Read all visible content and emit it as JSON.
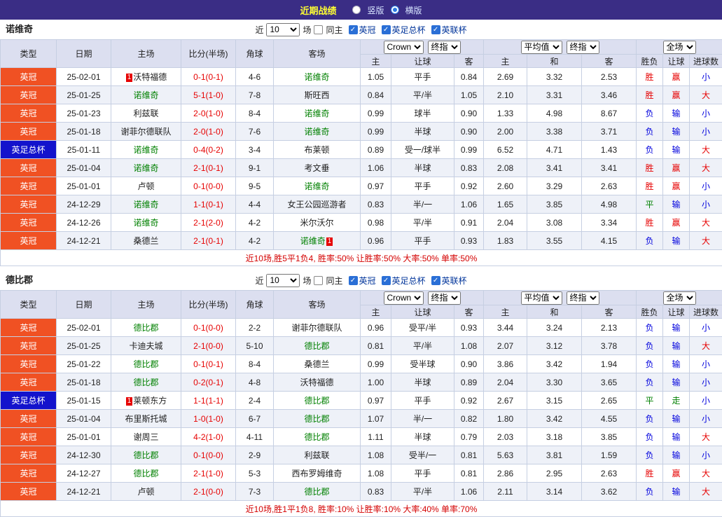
{
  "topbar": {
    "title": "近期战绩",
    "options": [
      {
        "label": "竖版",
        "selected": false
      },
      {
        "label": "横版",
        "selected": true
      }
    ]
  },
  "colors": {
    "topbar_bg": "#3a2d85",
    "league_championship_bg": "#f05123",
    "league_facup_bg": "#1313cc",
    "focus_team": "#008000",
    "win": "#e60000",
    "draw": "#008000",
    "loss": "#0000dd",
    "score": "#e60000",
    "summary": "#d40000"
  },
  "filter": {
    "near_label": "近",
    "count": "10",
    "matches_label": "场",
    "same_home": {
      "label": "同主",
      "checked": false
    },
    "leagues": [
      {
        "label": "英冠",
        "checked": true
      },
      {
        "label": "英足总杯",
        "checked": true
      },
      {
        "label": "英联杯",
        "checked": true
      }
    ]
  },
  "table_header": {
    "left_cols": [
      "类型",
      "日期",
      "主场",
      "比分(半场)",
      "角球",
      "客场"
    ],
    "groups": [
      {
        "selects": [
          "Crown",
          "终指"
        ],
        "cols": [
          "主",
          "让球",
          "客"
        ]
      },
      {
        "selects": [
          "平均值",
          "终指"
        ],
        "cols": [
          "主",
          "和",
          "客"
        ]
      },
      {
        "selects": [
          "全场"
        ],
        "cols": [
          "胜负",
          "让球",
          "进球数"
        ]
      }
    ]
  },
  "sections": [
    {
      "team": "诺维奇",
      "rows": [
        {
          "type": "英冠",
          "type_color": "orange",
          "date": "25-02-01",
          "home": "沃特福德",
          "home_badge": {
            "text": "1",
            "pos": "before"
          },
          "score": "0-1(0-1)",
          "corners": "4-6",
          "away": "诺维奇",
          "odds_asia": [
            "1.05",
            "平手",
            "0.84"
          ],
          "odds_europe": [
            "2.69",
            "3.32",
            "2.53"
          ],
          "results": [
            "胜",
            "赢",
            "小"
          ]
        },
        {
          "type": "英冠",
          "type_color": "orange",
          "date": "25-01-25",
          "home": "诺维奇",
          "score": "5-1(1-0)",
          "corners": "7-8",
          "away": "斯旺西",
          "odds_asia": [
            "0.84",
            "平/半",
            "1.05"
          ],
          "odds_europe": [
            "2.10",
            "3.31",
            "3.46"
          ],
          "results": [
            "胜",
            "赢",
            "大"
          ]
        },
        {
          "type": "英冠",
          "type_color": "orange",
          "date": "25-01-23",
          "home": "利兹联",
          "score": "2-0(1-0)",
          "corners": "8-4",
          "away": "诺维奇",
          "odds_asia": [
            "0.99",
            "球半",
            "0.90"
          ],
          "odds_europe": [
            "1.33",
            "4.98",
            "8.67"
          ],
          "results": [
            "负",
            "输",
            "小"
          ]
        },
        {
          "type": "英冠",
          "type_color": "orange",
          "date": "25-01-18",
          "home": "谢菲尔德联队",
          "score": "2-0(1-0)",
          "corners": "7-6",
          "away": "诺维奇",
          "odds_asia": [
            "0.99",
            "半球",
            "0.90"
          ],
          "odds_europe": [
            "2.00",
            "3.38",
            "3.71"
          ],
          "results": [
            "负",
            "输",
            "小"
          ]
        },
        {
          "type": "英足总杯",
          "type_color": "blue",
          "date": "25-01-11",
          "home": "诺维奇",
          "score": "0-4(0-2)",
          "corners": "3-4",
          "away": "布莱顿",
          "odds_asia": [
            "0.89",
            "受一/球半",
            "0.99"
          ],
          "odds_europe": [
            "6.52",
            "4.71",
            "1.43"
          ],
          "results": [
            "负",
            "输",
            "大"
          ]
        },
        {
          "type": "英冠",
          "type_color": "orange",
          "date": "25-01-04",
          "home": "诺维奇",
          "score": "2-1(0-1)",
          "corners": "9-1",
          "away": "考文垂",
          "odds_asia": [
            "1.06",
            "半球",
            "0.83"
          ],
          "odds_europe": [
            "2.08",
            "3.41",
            "3.41"
          ],
          "results": [
            "胜",
            "赢",
            "大"
          ]
        },
        {
          "type": "英冠",
          "type_color": "orange",
          "date": "25-01-01",
          "home": "卢顿",
          "score": "0-1(0-0)",
          "corners": "9-5",
          "away": "诺维奇",
          "odds_asia": [
            "0.97",
            "平手",
            "0.92"
          ],
          "odds_europe": [
            "2.60",
            "3.29",
            "2.63"
          ],
          "results": [
            "胜",
            "赢",
            "小"
          ]
        },
        {
          "type": "英冠",
          "type_color": "orange",
          "date": "24-12-29",
          "home": "诺维奇",
          "score": "1-1(0-1)",
          "corners": "4-4",
          "away": "女王公园巡游者",
          "odds_asia": [
            "0.83",
            "半/一",
            "1.06"
          ],
          "odds_europe": [
            "1.65",
            "3.85",
            "4.98"
          ],
          "results": [
            "平",
            "输",
            "小"
          ]
        },
        {
          "type": "英冠",
          "type_color": "orange",
          "date": "24-12-26",
          "home": "诺维奇",
          "score": "2-1(2-0)",
          "corners": "4-2",
          "away": "米尔沃尔",
          "odds_asia": [
            "0.98",
            "平/半",
            "0.91"
          ],
          "odds_europe": [
            "2.04",
            "3.08",
            "3.34"
          ],
          "results": [
            "胜",
            "赢",
            "大"
          ]
        },
        {
          "type": "英冠",
          "type_color": "orange",
          "date": "24-12-21",
          "home": "桑德兰",
          "score": "2-1(0-1)",
          "corners": "4-2",
          "away": "诺维奇",
          "away_badge": {
            "text": "1",
            "pos": "after"
          },
          "odds_asia": [
            "0.96",
            "平手",
            "0.93"
          ],
          "odds_europe": [
            "1.83",
            "3.55",
            "4.15"
          ],
          "results": [
            "负",
            "输",
            "大"
          ]
        }
      ],
      "summary": "近10场,胜5平1负4, 胜率:50% 让胜率:50% 大率:50% 单率:50%"
    },
    {
      "team": "德比郡",
      "rows": [
        {
          "type": "英冠",
          "type_color": "orange",
          "date": "25-02-01",
          "home": "德比郡",
          "score": "0-1(0-0)",
          "corners": "2-2",
          "away": "谢菲尔德联队",
          "odds_asia": [
            "0.96",
            "受平/半",
            "0.93"
          ],
          "odds_europe": [
            "3.44",
            "3.24",
            "2.13"
          ],
          "results": [
            "负",
            "输",
            "小"
          ]
        },
        {
          "type": "英冠",
          "type_color": "orange",
          "date": "25-01-25",
          "home": "卡迪夫城",
          "score": "2-1(0-0)",
          "corners": "5-10",
          "away": "德比郡",
          "odds_asia": [
            "0.81",
            "平/半",
            "1.08"
          ],
          "odds_europe": [
            "2.07",
            "3.12",
            "3.78"
          ],
          "results": [
            "负",
            "输",
            "大"
          ]
        },
        {
          "type": "英冠",
          "type_color": "orange",
          "date": "25-01-22",
          "home": "德比郡",
          "score": "0-1(0-1)",
          "corners": "8-4",
          "away": "桑德兰",
          "odds_asia": [
            "0.99",
            "受半球",
            "0.90"
          ],
          "odds_europe": [
            "3.86",
            "3.42",
            "1.94"
          ],
          "results": [
            "负",
            "输",
            "小"
          ]
        },
        {
          "type": "英冠",
          "type_color": "orange",
          "date": "25-01-18",
          "home": "德比郡",
          "score": "0-2(0-1)",
          "corners": "4-8",
          "away": "沃特福德",
          "odds_asia": [
            "1.00",
            "半球",
            "0.89"
          ],
          "odds_europe": [
            "2.04",
            "3.30",
            "3.65"
          ],
          "results": [
            "负",
            "输",
            "小"
          ]
        },
        {
          "type": "英足总杯",
          "type_color": "blue",
          "date": "25-01-15",
          "home": "莱顿东方",
          "home_badge": {
            "text": "1",
            "pos": "before"
          },
          "score": "1-1(1-1)",
          "corners": "2-4",
          "away": "德比郡",
          "odds_asia": [
            "0.97",
            "平手",
            "0.92"
          ],
          "odds_europe": [
            "2.67",
            "3.15",
            "2.65"
          ],
          "results": [
            "平",
            "走",
            "小"
          ]
        },
        {
          "type": "英冠",
          "type_color": "orange",
          "date": "25-01-04",
          "home": "布里斯托城",
          "score": "1-0(1-0)",
          "corners": "6-7",
          "away": "德比郡",
          "odds_asia": [
            "1.07",
            "半/一",
            "0.82"
          ],
          "odds_europe": [
            "1.80",
            "3.42",
            "4.55"
          ],
          "results": [
            "负",
            "输",
            "小"
          ]
        },
        {
          "type": "英冠",
          "type_color": "orange",
          "date": "25-01-01",
          "home": "谢周三",
          "score": "4-2(1-0)",
          "corners": "4-11",
          "away": "德比郡",
          "odds_asia": [
            "1.11",
            "半球",
            "0.79"
          ],
          "odds_europe": [
            "2.03",
            "3.18",
            "3.85"
          ],
          "results": [
            "负",
            "输",
            "大"
          ]
        },
        {
          "type": "英冠",
          "type_color": "orange",
          "date": "24-12-30",
          "home": "德比郡",
          "score": "0-1(0-0)",
          "corners": "2-9",
          "away": "利兹联",
          "odds_asia": [
            "1.08",
            "受半/一",
            "0.81"
          ],
          "odds_europe": [
            "5.63",
            "3.81",
            "1.59"
          ],
          "results": [
            "负",
            "输",
            "小"
          ]
        },
        {
          "type": "英冠",
          "type_color": "orange",
          "date": "24-12-27",
          "home": "德比郡",
          "score": "2-1(1-0)",
          "corners": "5-3",
          "away": "西布罗姆维奇",
          "odds_asia": [
            "1.08",
            "平手",
            "0.81"
          ],
          "odds_europe": [
            "2.86",
            "2.95",
            "2.63"
          ],
          "results": [
            "胜",
            "赢",
            "大"
          ]
        },
        {
          "type": "英冠",
          "type_color": "orange",
          "date": "24-12-21",
          "home": "卢顿",
          "score": "2-1(0-0)",
          "corners": "7-3",
          "away": "德比郡",
          "odds_asia": [
            "0.83",
            "平/半",
            "1.06"
          ],
          "odds_europe": [
            "2.11",
            "3.14",
            "3.62"
          ],
          "results": [
            "负",
            "输",
            "大"
          ]
        }
      ],
      "summary": "近10场,胜1平1负8, 胜率:10% 让胜率:10% 大率:40% 单率:70%"
    }
  ]
}
